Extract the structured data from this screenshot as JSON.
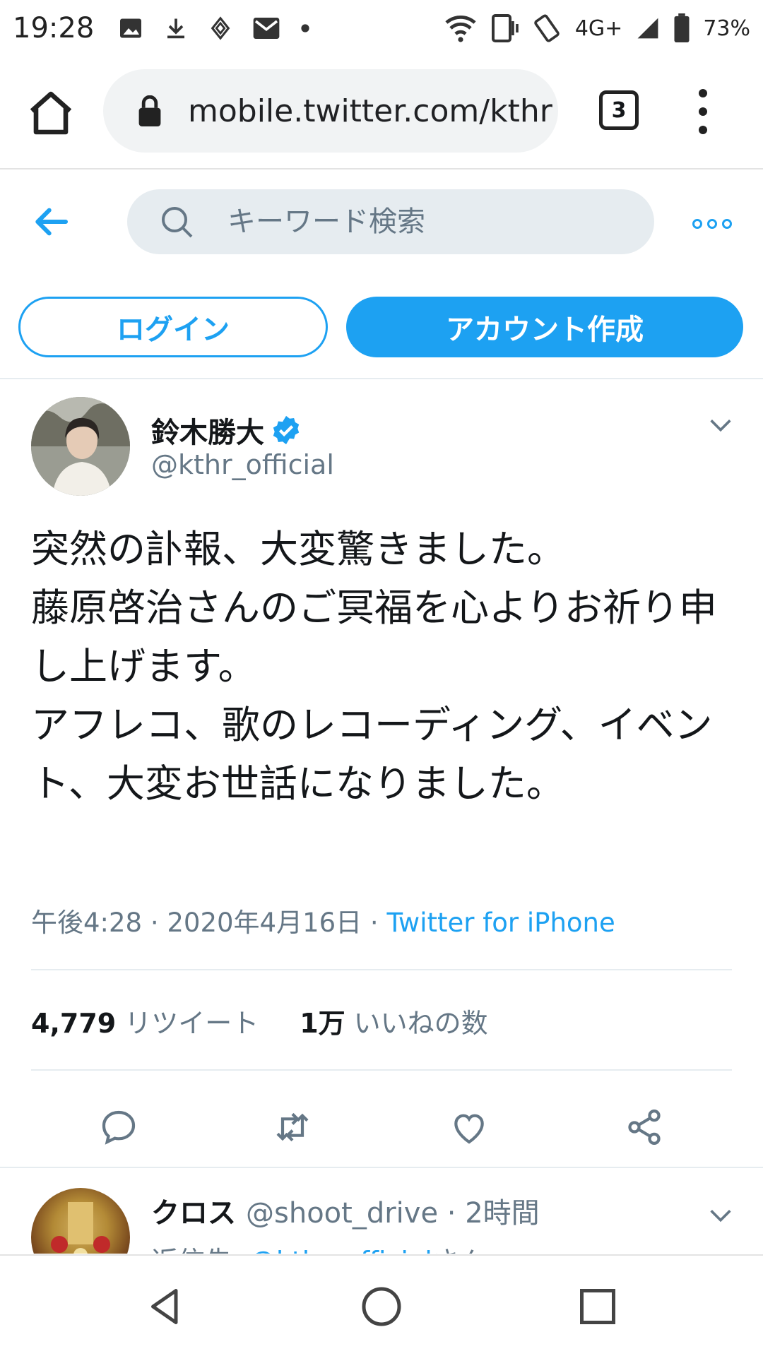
{
  "status_bar": {
    "time": "19:28",
    "network": "4G+",
    "battery": "73%"
  },
  "browser": {
    "url": "mobile.twitter.com/kthr",
    "tab_count": "3"
  },
  "twitter_header": {
    "search_placeholder": "キーワード検索",
    "login_label": "ログイン",
    "signup_label": "アカウント作成"
  },
  "tweet": {
    "author_name": "鈴木勝大",
    "author_handle": "@kthr_official",
    "verified": true,
    "text": "突然の訃報、大変驚きました。\n藤原啓治さんのご冥福を心よりお祈り申し上げます。\nアフレコ、歌のレコーディング、イベント、大変お世話になりました。",
    "timestamp": "午後4:28 · 2020年4月16日",
    "separator": " · ",
    "source": "Twitter for iPhone",
    "retweet_count": "4,779",
    "retweet_label": "リツイート",
    "like_count": "1万",
    "like_label": "いいねの数"
  },
  "reply": {
    "author_name": "クロス",
    "author_handle": "@shoot_drive",
    "time": "· 2時間",
    "reply_to_prefix": "返信先: ",
    "reply_to_handle": "@kthr_official",
    "reply_to_suffix": "さん"
  },
  "colors": {
    "twitter_blue": "#1da1f2",
    "secondary_text": "#657786",
    "search_bg": "#e6ecf0"
  }
}
